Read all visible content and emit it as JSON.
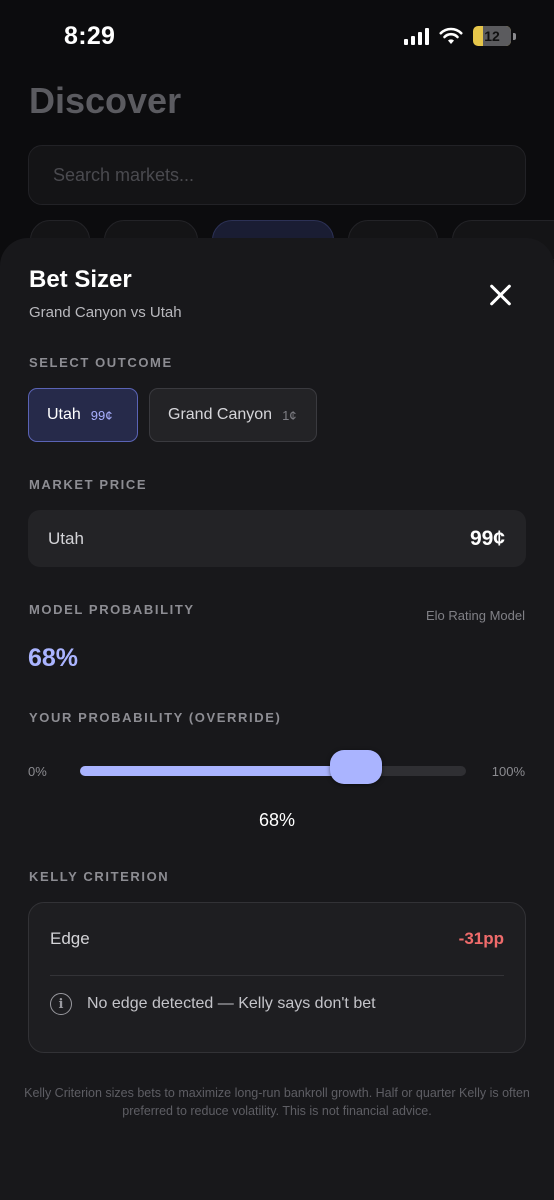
{
  "status_bar": {
    "time": "8:29",
    "battery": "12"
  },
  "background": {
    "title": "Discover",
    "search_placeholder": "Search markets..."
  },
  "sheet": {
    "title": "Bet Sizer",
    "subtitle": "Grand Canyon vs Utah",
    "select_outcome_label": "SELECT OUTCOME",
    "outcomes": [
      {
        "name": "Utah",
        "price": "99¢",
        "selected": true
      },
      {
        "name": "Grand Canyon",
        "price": "1¢",
        "selected": false
      }
    ],
    "market_price_label": "MARKET PRICE",
    "market": {
      "name": "Utah",
      "price": "99¢"
    },
    "model_probability_label": "MODEL PROBABILITY",
    "model_source": "Elo Rating Model",
    "model_probability": "68%",
    "override_label": "YOUR PROBABILITY (OVERRIDE)",
    "slider": {
      "min_label": "0%",
      "max_label": "100%",
      "value": 68,
      "value_label": "68%"
    },
    "kelly_label": "KELLY CRITERION",
    "kelly": {
      "edge_label": "Edge",
      "edge_value": "-31pp",
      "note": "No edge detected — Kelly says don't bet"
    },
    "disclaimer": "Kelly Criterion sizes bets to maximize long-run bankroll growth. Half or quarter Kelly is often preferred to reduce volatility. This is not financial advice."
  },
  "colors": {
    "accent": "#aab4ff",
    "negative": "#ef6b6b",
    "sheet_bg": "#18181b"
  }
}
